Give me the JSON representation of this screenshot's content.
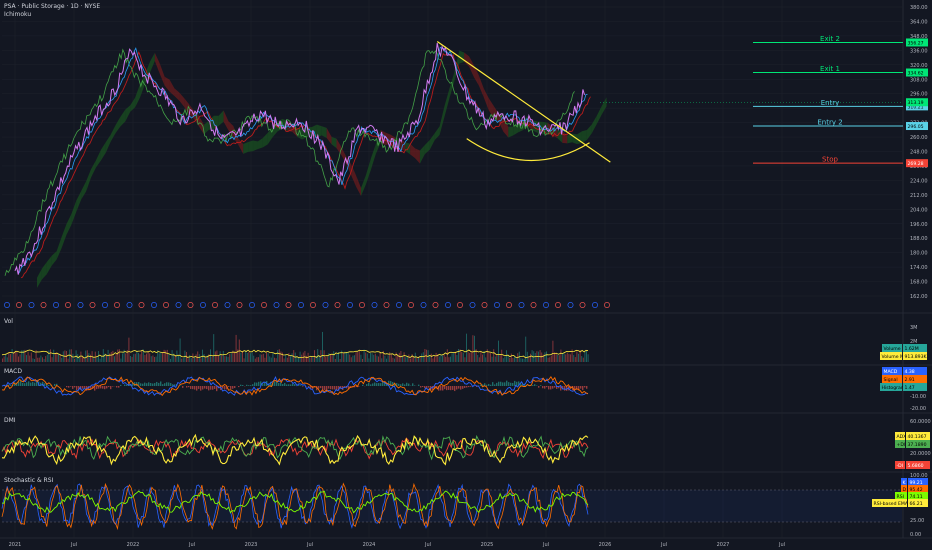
{
  "header": {
    "title": "PSA · Public Storage · 1D · NYSE",
    "indicator": "Ichimoku"
  },
  "panels": {
    "vol": "Vol",
    "macd": "MACD",
    "dmi": "DMI",
    "stoch": "Stochastic & RSI"
  },
  "colors": {
    "background": "#131722",
    "grid": "#1e222d",
    "price": "#d27bf2",
    "conversion": "#2a9df4",
    "base": "#b71c1c",
    "lagging": "#43a047",
    "cloud_up": "#1b5e20",
    "cloud_down": "#7f1d1d",
    "trendline": "#ffeb3b",
    "exit": "#00e676",
    "entry": "#5ad1e6",
    "stop": "#f44336",
    "volume_ma": "#ffeb3b",
    "macd": "#2962ff",
    "signal": "#ff6d00",
    "adx": "#ffeb3b",
    "di_plus": "#4caf50",
    "di_minus": "#f44336",
    "stoch_k": "#2962ff",
    "stoch_d": "#ff6d00",
    "rsi": "#7cfc00"
  },
  "chart_data": {
    "type": "line",
    "x_ticks": [
      "2021",
      "Jul",
      "2022",
      "Jul",
      "2023",
      "Jul",
      "2024",
      "Jul",
      "2025",
      "Jul",
      "2026",
      "Jul",
      "2027",
      "Jul"
    ],
    "y_ticks": [
      "380.00",
      "364.00",
      "348.00",
      "336.00",
      "320.00",
      "308.00",
      "296.00",
      "284.00",
      "272.00",
      "260.00",
      "248.00",
      "236.00",
      "224.00",
      "212.00",
      "204.00",
      "196.00",
      "188.00",
      "180.00",
      "174.00",
      "168.00",
      "162.00"
    ],
    "ylim": [
      162,
      384
    ],
    "price_series": {
      "x": [
        "2021-01",
        "2021-03",
        "2021-05",
        "2021-07",
        "2021-09",
        "2021-11",
        "2022-01",
        "2022-02",
        "2022-04",
        "2022-06",
        "2022-08",
        "2022-10",
        "2022-12",
        "2023-02",
        "2023-04",
        "2023-06",
        "2023-08",
        "2023-10",
        "2023-12",
        "2024-02",
        "2024-04",
        "2024-06",
        "2024-08",
        "2024-09",
        "2024-11",
        "2025-01",
        "2025-03",
        "2025-05",
        "2025-07",
        "2025-09",
        "2025-11"
      ],
      "y": [
        190,
        210,
        245,
        275,
        300,
        320,
        352,
        335,
        320,
        300,
        310,
        285,
        290,
        305,
        296,
        300,
        285,
        255,
        295,
        290,
        280,
        300,
        352,
        350,
        318,
        298,
        305,
        300,
        293,
        295,
        320
      ]
    },
    "levels": [
      {
        "name": "Exit 2",
        "value": 356.27
      },
      {
        "name": "Exit 1",
        "value": 334.62
      },
      {
        "name": "Entry",
        "value": 310.21
      },
      {
        "name": "Entry 2",
        "value": 296.05
      },
      {
        "name": "Stop",
        "value": 269.28
      }
    ],
    "current_price": 313.19,
    "volume": {
      "y_ticks": [
        "3M",
        "2M"
      ],
      "volume": "1.62M",
      "volume_ma": "913.893K"
    },
    "macd": {
      "y_ticks": [
        "10.00",
        "-10.00",
        "-20.00"
      ],
      "macd": "4.38",
      "signal": "2.91",
      "histogram": "1.47"
    },
    "dmi": {
      "y_ticks": [
        "60.0000",
        "20.0000"
      ],
      "adx": "40.1367",
      "di_plus": "37.1890",
      "di_minus": "5.6860"
    },
    "stoch_rsi": {
      "y_ticks": [
        "100.00",
        "50.00",
        "25.00",
        "0.00"
      ],
      "k": "99.21",
      "d": "95.42",
      "rsi": "74.11",
      "rsi_based_ema": "66.21"
    }
  }
}
